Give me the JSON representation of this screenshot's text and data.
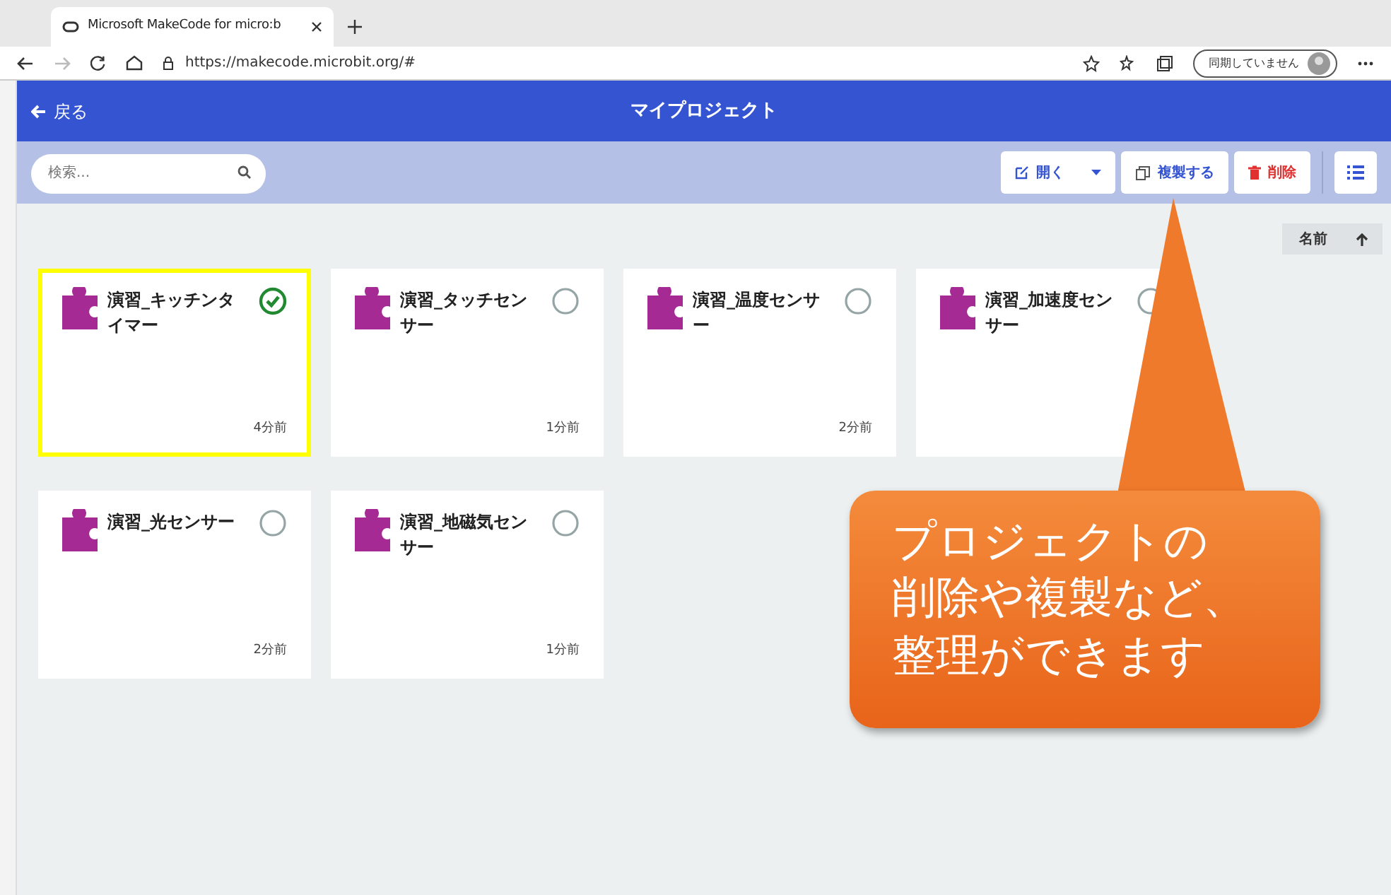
{
  "browser": {
    "tab_title": "Microsoft MakeCode for micro:b",
    "url": "https://makecode.microbit.org/#",
    "sync_label": "同期していません"
  },
  "header": {
    "back": "戻る",
    "title": "マイプロジェクト"
  },
  "toolbar": {
    "search": {
      "placeholder": "検索..."
    },
    "buttons": [
      {
        "kind": "open",
        "label": "開く"
      },
      {
        "kind": "duplicate",
        "label": "複製する"
      },
      {
        "kind": "delete",
        "label": "削除"
      }
    ]
  },
  "sort": {
    "label": "名前"
  },
  "projects": [
    {
      "name": "演習_キッチンタイマー",
      "time": "4分前",
      "selected": true
    },
    {
      "name": "演習_タッチセンサー",
      "time": "1分前",
      "selected": false
    },
    {
      "name": "演習_温度センサー",
      "time": "2分前",
      "selected": false
    },
    {
      "name": "演習_加速度センサー",
      "selected": false
    },
    {
      "name": "演習_光センサー",
      "time": "2分前",
      "selected": false
    },
    {
      "name": "演習_地磁気センサー",
      "time": "1分前",
      "selected": false
    }
  ],
  "callout": {
    "lines": [
      "プロジェクトの",
      "削除や複製など、",
      "整理ができます"
    ]
  }
}
